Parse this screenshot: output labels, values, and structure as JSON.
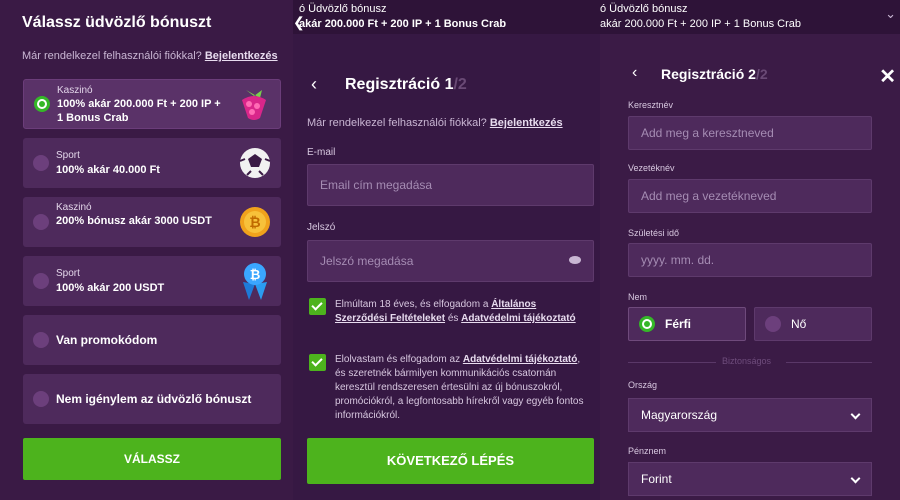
{
  "panel1": {
    "title": "Válassz üdvözlő bónuszt",
    "login_prefix": "Már rendelkezel felhasználói fiókkal?",
    "login_link": "Bejelentkezés",
    "options": [
      {
        "category": "Kaszinó",
        "text": "100% akár 200.000 Ft + 200 IP + 1 Bonus Crab",
        "icon": "raspberry-icon",
        "selected": true
      },
      {
        "category": "Sport",
        "text": "100% akár 40.000 Ft",
        "icon": "soccer-ball-icon",
        "selected": false
      },
      {
        "category": "Kaszinó",
        "text": "200% bónusz akár 3000 USDT",
        "icon": "bitcoin-coin-icon",
        "selected": false
      },
      {
        "category": "Sport",
        "text": "100% akár 200 USDT",
        "icon": "bitcoin-crystal-icon",
        "selected": false
      }
    ],
    "promo": "Van promokódom",
    "no_bonus": "Nem igénylem az üdvözlő bónuszt",
    "button": "VÁLASSZ"
  },
  "panel2": {
    "strip_line1": "ó Üdvözlő bónusz",
    "strip_line2": "akár 200.000 Ft + 200 IP + 1 Bonus Crab",
    "title": "Regisztráció 1",
    "title_step": "/2",
    "login_prefix": "Már rendelkezel felhasználói fiókkal?",
    "login_link": "Bejelentkezés",
    "email_label": "E-mail",
    "email_placeholder": "Email cím megadása",
    "password_label": "Jelszó",
    "password_placeholder": "Jelszó megadása",
    "consent1_prefix": "Elmúltam 18 éves, és elfogadom a",
    "consent1_link1": "Általános Szerződési Feltételeket",
    "consent1_mid": "és",
    "consent1_link2": "Adatvédelmi tájékoztató",
    "consent2_prefix": "Elolvastam és elfogadom az",
    "consent2_link": "Adatvédelmi tájékoztató",
    "consent2_rest": ", és szeretnék bármilyen kommunikációs csatornán keresztül rendszeresen értesülni az új bónuszokról, promóciókról, a legfontosabb hírekről vagy egyéb fontos információkról.",
    "button": "KÖVETKEZŐ LÉPÉS"
  },
  "panel3": {
    "strip_line1": "ó Üdvözlő bónusz",
    "strip_line2": "akár 200.000 Ft + 200 IP + 1 Bonus Crab",
    "title": "Regisztráció 2",
    "title_step": "/2",
    "first_name_label": "Keresztnév",
    "first_name_placeholder": "Add meg a keresztneved",
    "last_name_label": "Vezetéknév",
    "last_name_placeholder": "Add meg a vezetékneved",
    "dob_label": "Születési idő",
    "dob_placeholder": "yyyy. mm. dd.",
    "gender_label": "Nem",
    "gender_male": "Férfi",
    "gender_female": "Nő",
    "divider": "Biztonságos",
    "country_label": "Ország",
    "country_value": "Magyarország",
    "currency_label": "Pénznem",
    "currency_value": "Forint"
  },
  "colors": {
    "accent_green": "#4db31d",
    "panel_bg": "#3a1a45",
    "field_bg": "#4e2a5c"
  }
}
